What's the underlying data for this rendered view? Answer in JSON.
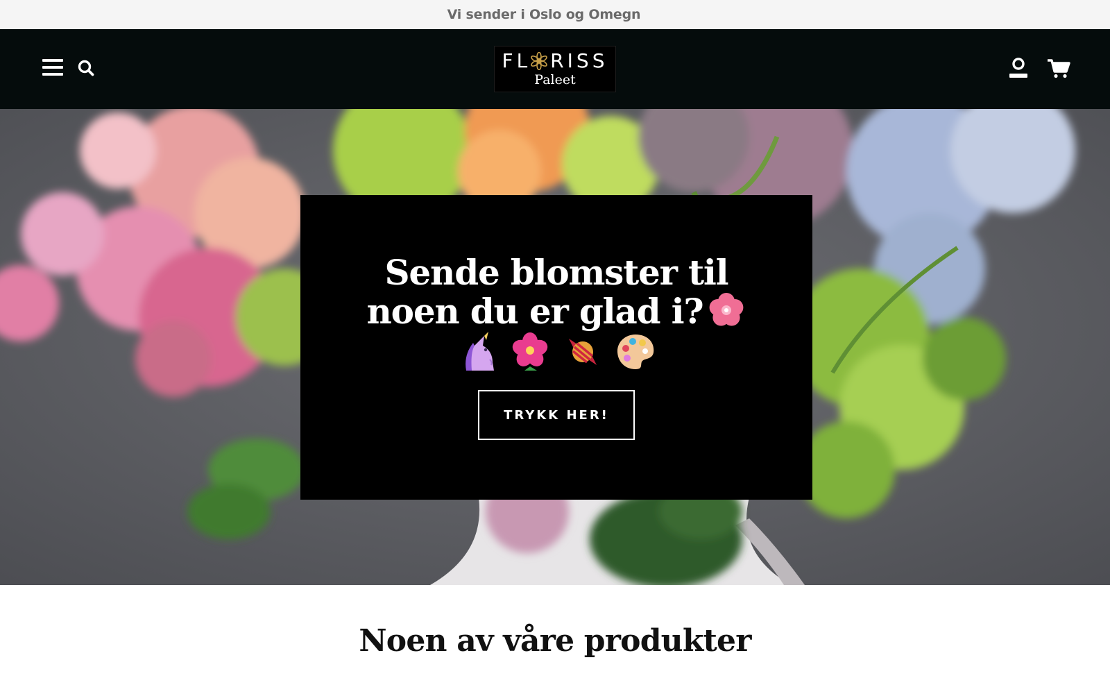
{
  "announcement": {
    "text": "Vi sender i Oslo og Omegn"
  },
  "header": {
    "logo": {
      "name": "FLORISS",
      "name_left": "FL",
      "name_right": "RISS",
      "sub": "Paleet"
    },
    "icons": {
      "menu": "hamburger-menu-icon",
      "search": "search-icon",
      "account": "user-icon",
      "cart": "shopping-cart-icon"
    }
  },
  "hero": {
    "title": "Sende blomster til noen du er glad i?",
    "title_emoji": "cherry-blossom",
    "emojis": [
      "unicorn",
      "hibiscus",
      "candy",
      "artist-palette"
    ],
    "cta_label": "TRYKK HER!"
  },
  "products": {
    "heading": "Noen av våre produkter"
  },
  "colors": {
    "announcement_bg": "#f5f5f5",
    "announcement_text": "#6a6a6a",
    "header_bg": "#050c0c",
    "promo_bg": "#000000",
    "text_light": "#ffffff",
    "text_dark": "#111111"
  }
}
